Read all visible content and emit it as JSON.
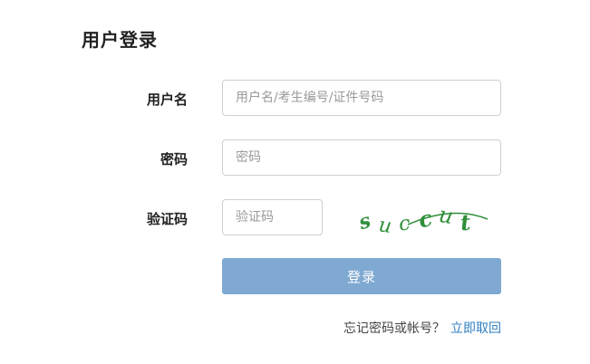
{
  "page": {
    "title": "用户登录"
  },
  "form": {
    "username_label": "用户名",
    "username_placeholder": "用户名/考生编号/证件号码",
    "password_label": "密码",
    "password_placeholder": "密码",
    "captcha_label": "验证码",
    "captcha_placeholder": "验证码",
    "captcha_image_text": "succut",
    "login_button": "登录"
  },
  "footer": {
    "forgot_text": "忘记密码或帐号？",
    "retrieve_link": "立即取回"
  },
  "colors": {
    "button_bg": "#7fa9d1",
    "link": "#2f7fc1",
    "captcha_text": "#2f8f3a"
  }
}
